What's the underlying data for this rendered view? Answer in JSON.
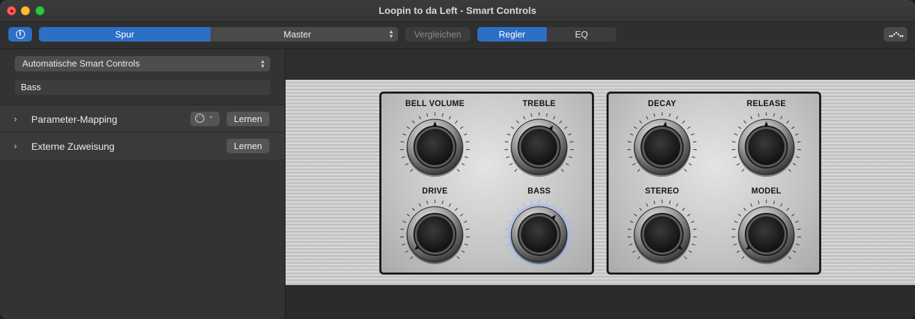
{
  "window": {
    "title": "Loopin to da Left - Smart Controls"
  },
  "toolbar": {
    "spur": "Spur",
    "master": "Master",
    "vergleichen": "Vergleichen",
    "regler": "Regler",
    "eq": "EQ"
  },
  "sidebar": {
    "mapping_dropdown": "Automatische Smart Controls",
    "name_field": "Bass",
    "rows": [
      {
        "label": "Parameter-Mapping",
        "button": "Lernen"
      },
      {
        "label": "Externe Zuweisung",
        "button": "Lernen"
      }
    ]
  },
  "knobs": [
    {
      "label": "BELL VOLUME",
      "value": 0.5
    },
    {
      "label": "TREBLE",
      "value": 0.62
    },
    {
      "label": "DRIVE",
      "value": 0.03
    },
    {
      "label": "BASS",
      "value": 0.65
    },
    {
      "label": "DECAY",
      "value": 0.53
    },
    {
      "label": "RELEASE",
      "value": 0.5
    },
    {
      "label": "STEREO",
      "value": 0.97
    },
    {
      "label": "MODEL",
      "value": 0.03
    }
  ],
  "colors": {
    "accent": "#2d6fc5",
    "highlight_glow": "#8fb6ff"
  },
  "icons": [
    "info-icon",
    "chevron-updown-icon",
    "chevron-right-icon",
    "more-icon",
    "chevron-down-icon",
    "peak-view-icon"
  ]
}
